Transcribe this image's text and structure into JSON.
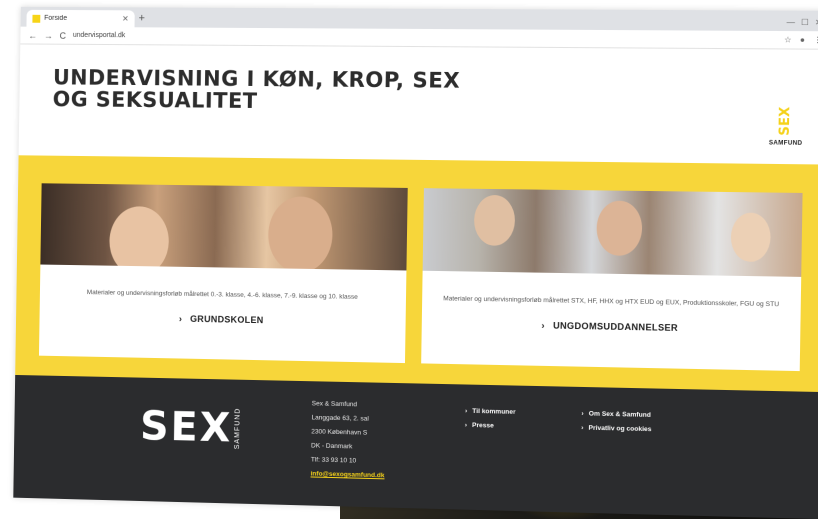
{
  "browser": {
    "tab_title": "Forside",
    "tab_close": "✕",
    "new_tab": "+",
    "url": "undervisportal.dk",
    "nav_back": "←",
    "nav_forward": "→",
    "nav_reload": "C"
  },
  "page": {
    "title": "UNDERVISNING I KØN, KROP, SEX OG SEKSUALITET",
    "logo_word": "SEX",
    "logo_sub": "SAMFUND"
  },
  "cards": [
    {
      "description": "Materialer og undervisningsforløb målrettet 0.-3. klasse, 4.-6. klasse, 7.-9. klasse og 10. klasse",
      "link_label": "GRUNDSKOLEN"
    },
    {
      "description": "Materialer og undervisningsforløb målrettet STX, HF, HHX og HTX EUD og EUX, Produktionsskoler, FGU og STU",
      "link_label": "UNGDOMSUDDANNELSER"
    }
  ],
  "footer": {
    "logo_word": "SEX",
    "logo_sub": "SAMFUND",
    "address": [
      "Sex & Samfund",
      "Langgade 63, 2. sal",
      "2300 København S",
      "DK - Danmark",
      "Tlf: 33 93 10 10"
    ],
    "email": "info@sexogsamfund.dk",
    "links_col1": [
      "Til kommuner",
      "Presse"
    ],
    "links_col2": [
      "Om Sex & Samfund",
      "Privatliv og cookies"
    ]
  },
  "colors": {
    "accent_yellow": "#f7d63a",
    "footer_dark": "#2b2c2e"
  }
}
